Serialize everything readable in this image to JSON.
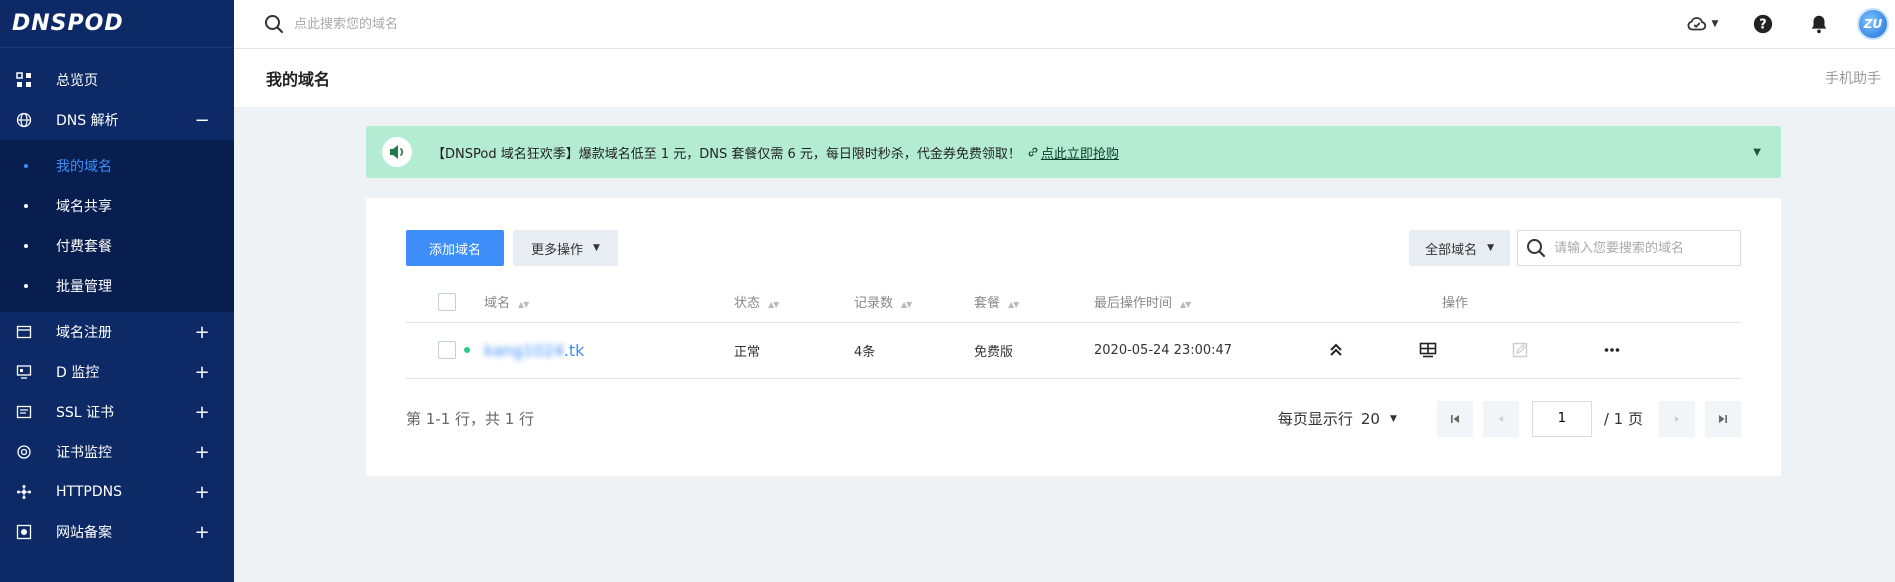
{
  "brand": {
    "logo_text": "DNSPOD"
  },
  "sidebar": {
    "items": [
      {
        "label": "总览页",
        "icon": "grid-icon",
        "toggle": ""
      },
      {
        "label": "DNS 解析",
        "icon": "globe-icon",
        "toggle": "−"
      },
      {
        "label": "域名注册",
        "icon": "calendar-icon",
        "toggle": "+"
      },
      {
        "label": "D 监控",
        "icon": "monitor-icon",
        "toggle": "+"
      },
      {
        "label": "SSL 证书",
        "icon": "certificate-icon",
        "toggle": "+"
      },
      {
        "label": "证书监控",
        "icon": "target-icon",
        "toggle": "+"
      },
      {
        "label": "HTTPDNS",
        "icon": "network-icon",
        "toggle": "+"
      },
      {
        "label": "网站备案",
        "icon": "record-icon",
        "toggle": "+"
      }
    ],
    "dns_sub": [
      {
        "label": "我的域名",
        "active": true
      },
      {
        "label": "域名共享",
        "active": false
      },
      {
        "label": "付费套餐",
        "active": false
      },
      {
        "label": "批量管理",
        "active": false
      }
    ]
  },
  "topbar": {
    "search_placeholder": "点此搜索您的域名",
    "avatar_text": "ZU"
  },
  "header": {
    "title": "我的域名",
    "helper": "手机助手"
  },
  "banner": {
    "text": "【DNSPod 域名狂欢季】爆款域名低至 1 元，DNS 套餐仅需 6 元，每日限时秒杀，代金券免费领取！",
    "link": "点此立即抢购",
    "bg_color": "#b3ecd3"
  },
  "toolbar": {
    "add_label": "添加域名",
    "more_label": "更多操作",
    "filter_label": "全部域名",
    "search_placeholder": "请输入您要搜索的域名"
  },
  "table": {
    "headers": {
      "domain": "域名",
      "status": "状态",
      "records": "记录数",
      "plan": "套餐",
      "last_op": "最后操作时间",
      "actions": "操作"
    },
    "rows": [
      {
        "domain_hidden": "kang1024",
        "domain_suffix": ".tk",
        "status": "正常",
        "records": "4条",
        "plan": "免费版",
        "last_op": "2020-05-24 23:00:47"
      }
    ]
  },
  "pagination": {
    "summary": "第 1-1 行，共 1 行",
    "per_page_label": "每页显示行",
    "per_page_value": "20",
    "current_page": "1",
    "total_pages": "/ 1 页"
  },
  "colors": {
    "sidebar_bg": "#0d2a66",
    "accent": "#3d8ef8",
    "status_ok": "#29cc85"
  }
}
